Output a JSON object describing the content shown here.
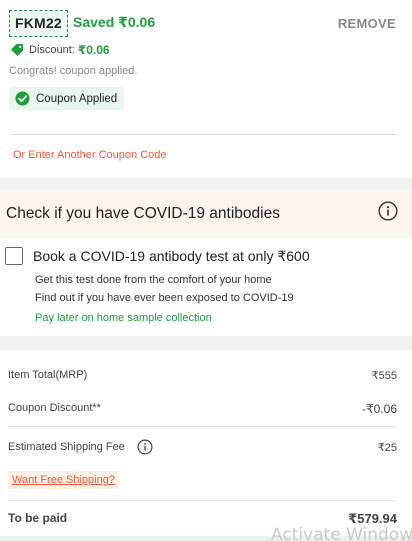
{
  "coupon": {
    "code": "FKM22",
    "saved_text": "Saved ₹0.06",
    "remove_label": "REMOVE",
    "discount_label": "Discount:",
    "discount_value": "₹0.06",
    "congrats_text": "Congrats! coupon applied.",
    "applied_label": "Coupon Applied",
    "other_coupon_label": "Or Enter Another Coupon Code",
    "icons": {
      "tag": "tag-icon",
      "check": "check-circle-icon"
    },
    "colors": {
      "success": "#1e9e3e",
      "accent": "#f0573b"
    }
  },
  "covid": {
    "title": "Check if you have COVID-19 antibodies",
    "book_label": "Book a COVID-19 antibody test at only ₹600",
    "desc_lines": [
      "Get this test done from the comfort of your home",
      "Find out if you have ever been exposed to COVID-19"
    ],
    "pay_later": "Pay later on home sample collection",
    "checked": false,
    "icons": {
      "info": "info-icon"
    }
  },
  "summary": {
    "item_total_label": "Item Total(MRP)",
    "item_total_value": "₹555",
    "coupon_discount_label": "Coupon Discount**",
    "coupon_discount_value": "-₹0.06",
    "shipping_label": "Estimated Shipping Fee",
    "shipping_value": "₹25",
    "free_shipping_link": "Want Free Shipping?",
    "to_be_paid_label": "To be paid",
    "to_be_paid_value": "₹579.94"
  },
  "watermark": "Activate Windows"
}
